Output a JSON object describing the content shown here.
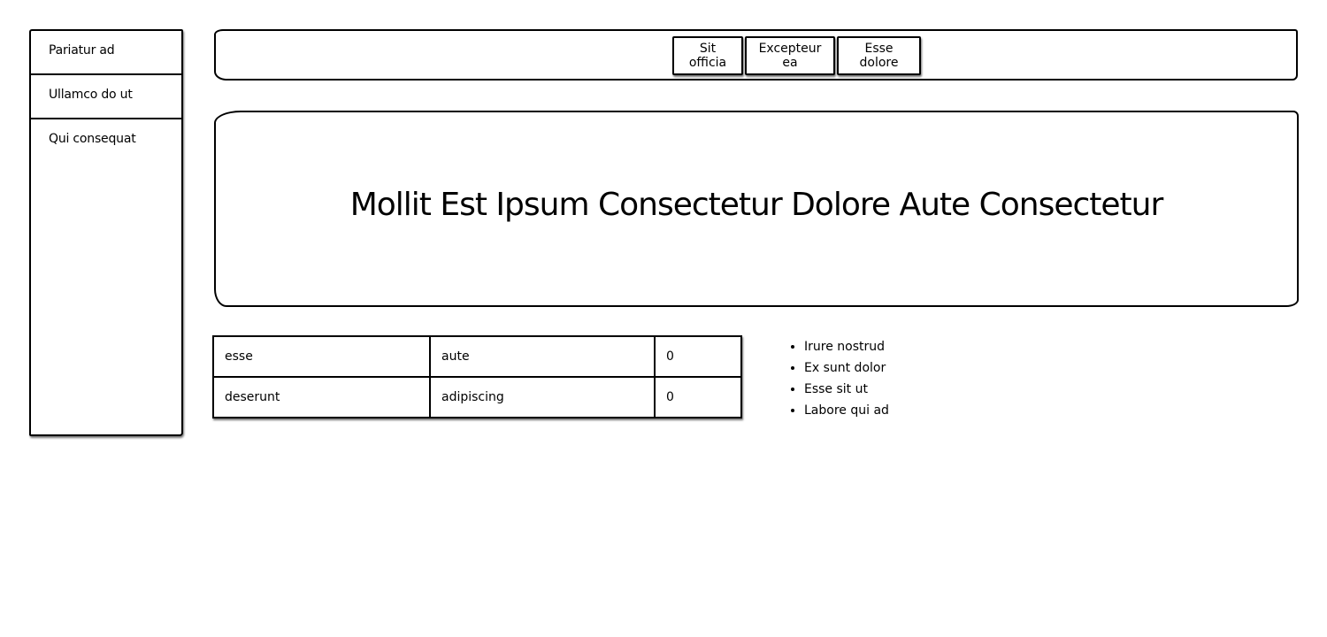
{
  "sidebar": {
    "items": [
      {
        "label": "Pariatur ad"
      },
      {
        "label": "Ullamco do ut"
      },
      {
        "label": "Qui consequat"
      }
    ]
  },
  "navbar": {
    "buttons": [
      {
        "label": "Sit officia"
      },
      {
        "label": "Excepteur ea"
      },
      {
        "label": "Esse dolore"
      }
    ]
  },
  "hero": {
    "title": "Mollit Est Ipsum Consectetur Dolore Aute Consectetur"
  },
  "table": {
    "rows": [
      [
        "esse",
        "aute",
        "0"
      ],
      [
        "deserunt",
        "adipiscing",
        "0"
      ]
    ]
  },
  "list": {
    "items": [
      "Irure nostrud",
      "Ex sunt dolor",
      "Esse sit ut",
      "Labore qui ad"
    ]
  }
}
